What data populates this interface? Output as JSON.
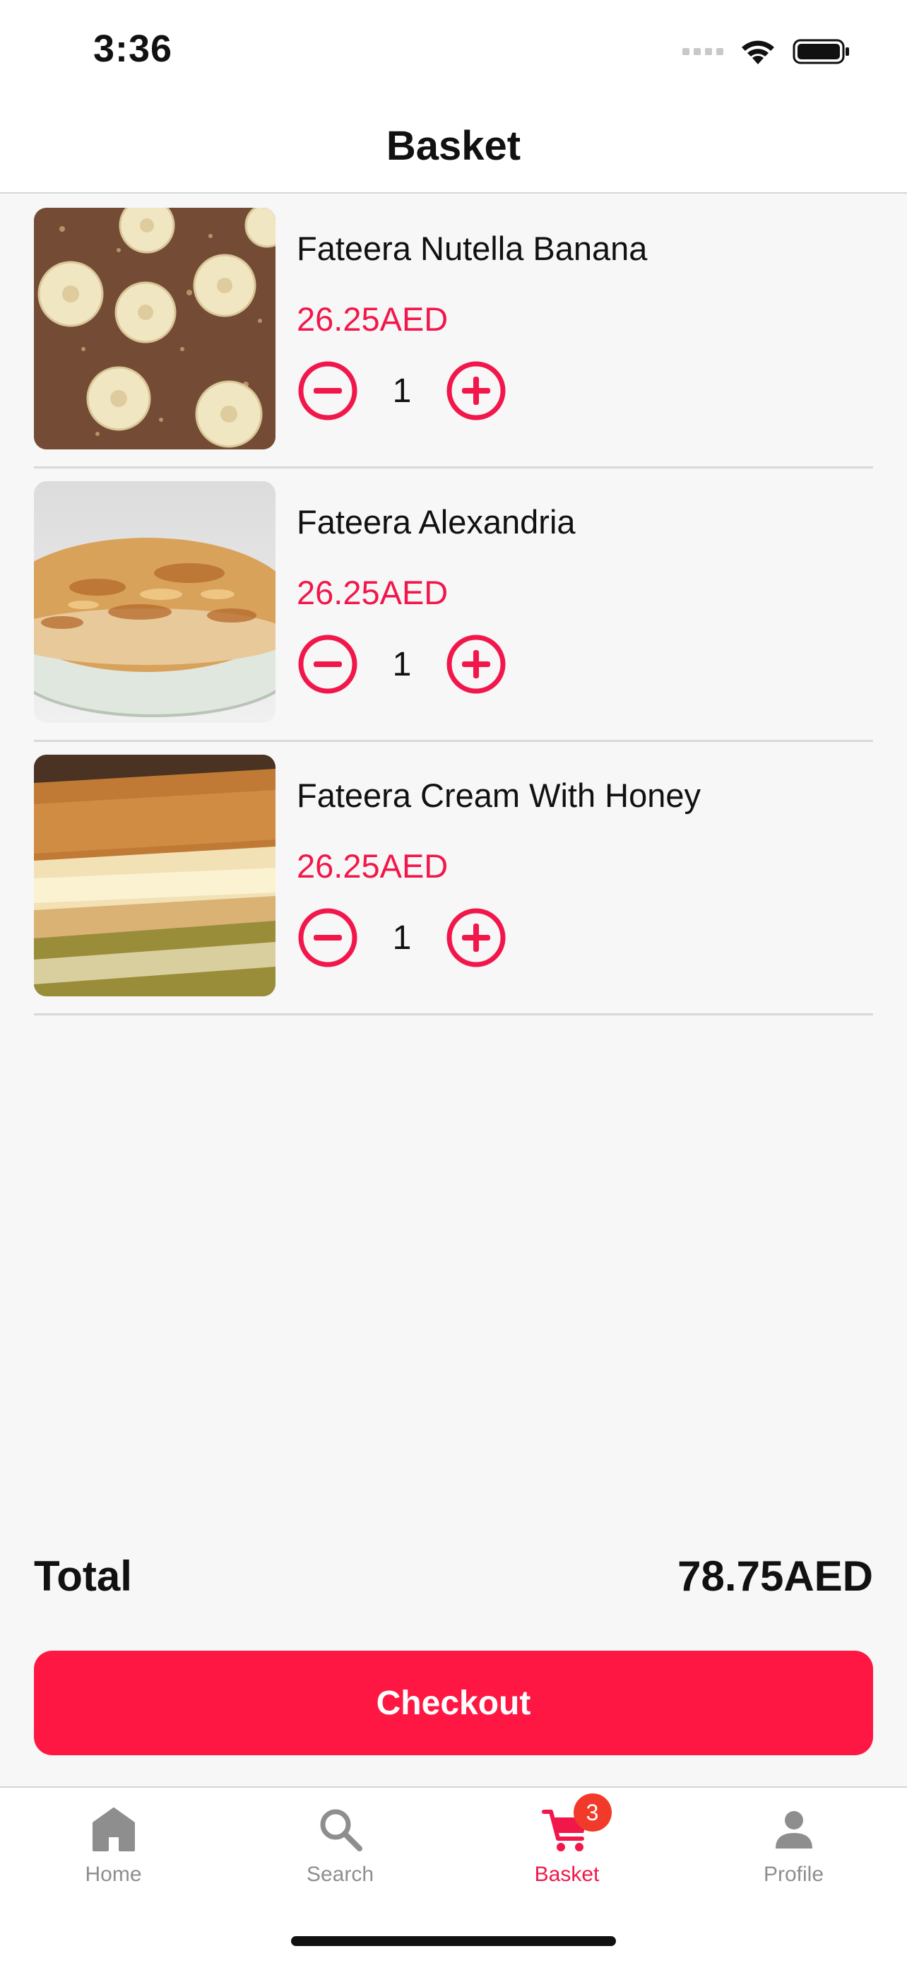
{
  "status_bar": {
    "time": "3:36"
  },
  "nav": {
    "title": "Basket"
  },
  "items": [
    {
      "name": "Fateera Nutella Banana",
      "price": "26.25AED",
      "quantity": "1"
    },
    {
      "name": "Fateera Alexandria",
      "price": "26.25AED",
      "quantity": "1"
    },
    {
      "name": "Fateera Cream With Honey",
      "price": "26.25AED",
      "quantity": "1"
    }
  ],
  "summary": {
    "total_label": "Total",
    "total_value": "78.75AED"
  },
  "checkout": {
    "label": "Checkout"
  },
  "tabs": [
    {
      "label": "Home",
      "icon": "home-icon"
    },
    {
      "label": "Search",
      "icon": "search-icon"
    },
    {
      "label": "Basket",
      "icon": "cart-icon",
      "badge": "3",
      "active": true
    },
    {
      "label": "Profile",
      "icon": "person-icon"
    }
  ],
  "colors": {
    "accent": "#f2174b",
    "button": "#ff1744",
    "badge": "#f23a2a",
    "inactive": "#8e8e8e"
  }
}
